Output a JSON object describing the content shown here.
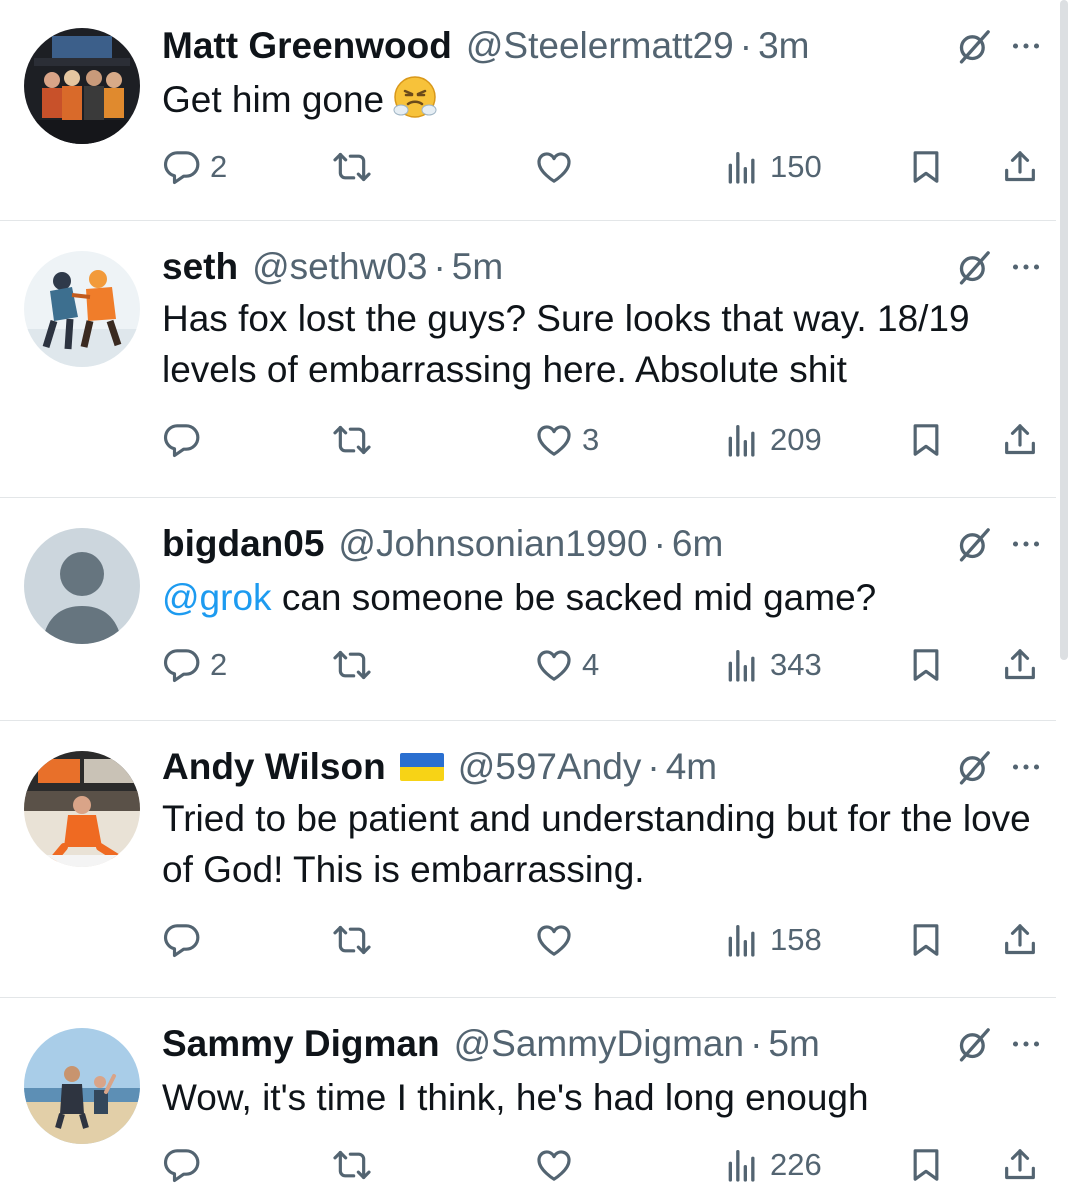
{
  "accent_color": "#1d9bf0",
  "tweets": [
    {
      "name": "Matt Greenwood",
      "handle": "@Steelermatt29",
      "dot": "·",
      "time": "3m",
      "text": "Get him gone",
      "emoji": "face-with-steam-from-nose",
      "replies": "2",
      "retweets": "",
      "likes": "",
      "views": "150"
    },
    {
      "name": "seth",
      "handle": "@sethw03",
      "dot": "·",
      "time": "5m",
      "text": "Has fox lost the guys? Sure looks that way. 18/19 levels of embarrassing here. Absolute shit",
      "replies": "",
      "retweets": "",
      "likes": "3",
      "views": "209"
    },
    {
      "name": "bigdan05",
      "handle": "@Johnsonian1990",
      "dot": "·",
      "time": "6m",
      "mention": "@grok",
      "text": " can someone be sacked mid game?",
      "replies": "2",
      "retweets": "",
      "likes": "4",
      "views": "343"
    },
    {
      "name": "Andy Wilson",
      "flag": "ukraine-flag",
      "handle": "@597Andy",
      "dot": "·",
      "time": "4m",
      "text": "Tried to be patient and understanding but for the love of God! This is embarrassing.",
      "replies": "",
      "retweets": "",
      "likes": "",
      "views": "158"
    },
    {
      "name": "Sammy Digman",
      "handle": "@SammyDigman",
      "dot": "·",
      "time": "5m",
      "text": "Wow, it's time I think, he's had long enough",
      "replies": "",
      "retweets": "",
      "likes": "",
      "views": "226"
    }
  ]
}
